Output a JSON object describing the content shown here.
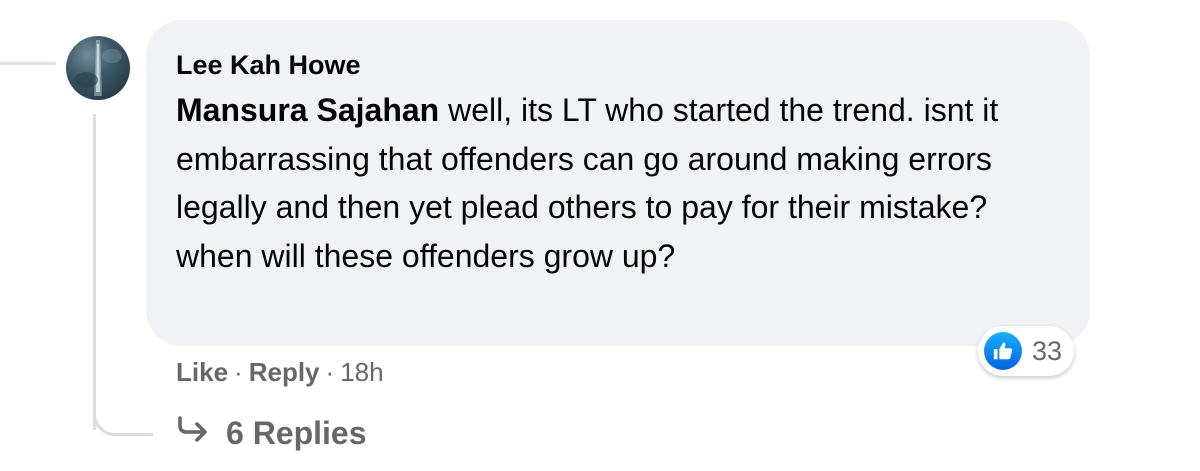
{
  "comment": {
    "author": "Lee Kah Howe",
    "mention": "Mansura Sajahan",
    "text": " well, its LT who started the trend. isnt it embarrassing that offenders can go around making errors legally and then yet plead others to pay for their mistake? when will these offenders grow up?",
    "reactions": {
      "icon": "like-icon",
      "count": "33",
      "color": "#1877f2"
    },
    "actions": {
      "like_label": "Like",
      "separator": "·",
      "reply_label": "Reply",
      "timestamp": "18h"
    },
    "replies": {
      "icon": "reply-arrow-icon",
      "label": "6 Replies"
    }
  },
  "colors": {
    "bubble": "#f0f2f5",
    "secondary_text": "#65676b",
    "thread_line": "#dadde1"
  }
}
